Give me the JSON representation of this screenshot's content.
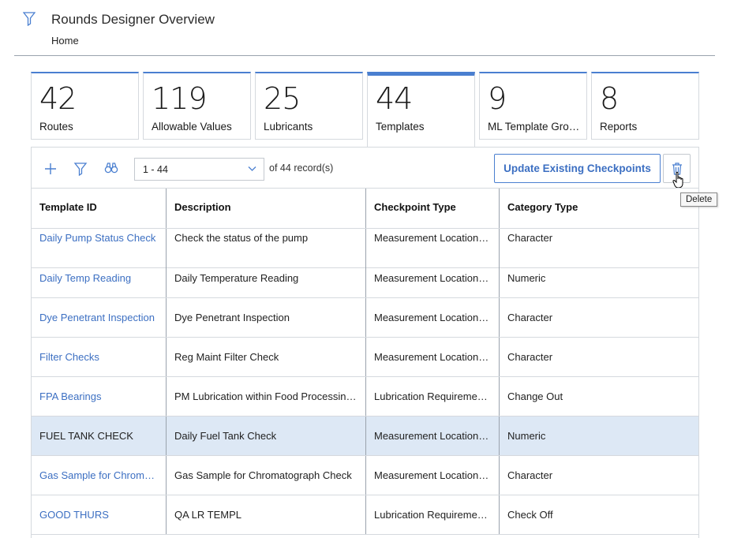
{
  "header": {
    "title": "Rounds Designer Overview",
    "breadcrumb": "Home"
  },
  "tiles": [
    {
      "count": "42",
      "label": "Routes"
    },
    {
      "count": "119",
      "label": "Allowable Values"
    },
    {
      "count": "25",
      "label": "Lubricants"
    },
    {
      "count": "44",
      "label": "Templates"
    },
    {
      "count": "9",
      "label": "ML Template Groups"
    },
    {
      "count": "8",
      "label": "Reports"
    }
  ],
  "toolbar": {
    "range": "1 - 44",
    "of_text": "of",
    "total": "44",
    "records_label": "record(s)",
    "update_button": "Update Existing Checkpoints",
    "delete_tooltip": "Delete"
  },
  "table": {
    "headers": [
      "Template ID",
      "Description",
      "Checkpoint Type",
      "Category Type"
    ],
    "rows": [
      {
        "id": "Daily Pump Status Check",
        "desc": "Check the status of the pump",
        "checkpoint": "Measurement Location Template",
        "category": "Character"
      },
      {
        "id": "Daily Temp Reading",
        "desc": "Daily Temperature Reading",
        "checkpoint": "Measurement Location Template",
        "category": "Numeric"
      },
      {
        "id": "Dye Penetrant Inspection",
        "desc": "Dye Penetrant Inspection",
        "checkpoint": "Measurement Location Template",
        "category": "Character"
      },
      {
        "id": "Filter Checks",
        "desc": "Reg Maint Filter Check",
        "checkpoint": "Measurement Location Template",
        "category": "Character"
      },
      {
        "id": "FPA Bearings",
        "desc": "PM Lubrication within Food Processing Area",
        "checkpoint": "Lubrication Requirement Template",
        "category": "Change Out"
      },
      {
        "id": "FUEL TANK CHECK",
        "desc": "Daily Fuel Tank Check",
        "checkpoint": "Measurement Location Template",
        "category": "Numeric"
      },
      {
        "id": "Gas Sample for Chromatograph",
        "desc": "Gas Sample for Chromatograph Check",
        "checkpoint": "Measurement Location Template",
        "category": "Character"
      },
      {
        "id": "GOOD THURS",
        "desc": "QA LR TEMPL",
        "checkpoint": "Lubrication Requirement Template",
        "category": "Check Off"
      }
    ]
  },
  "colors": {
    "accent": "#4a7fd0",
    "link": "#3c6fc2",
    "selected_row": "#dde8f5"
  }
}
